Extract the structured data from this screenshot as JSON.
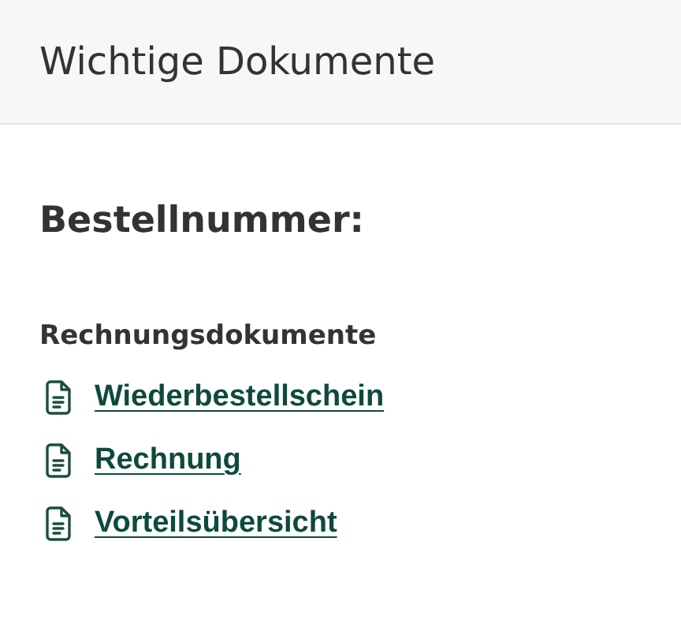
{
  "header": {
    "title": "Wichtige Dokumente"
  },
  "order": {
    "label": "Bestellnummer:"
  },
  "section": {
    "title": "Rechnungsdokumente",
    "documents": [
      {
        "label": "Wiederbestellschein"
      },
      {
        "label": "Rechnung"
      },
      {
        "label": "Vorteilsübersicht"
      }
    ]
  }
}
